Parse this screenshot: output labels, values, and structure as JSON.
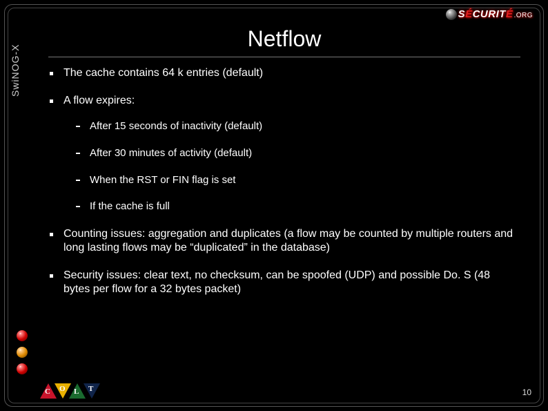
{
  "side_label": "SwiNOG-X",
  "top_logo": {
    "prefix": "S",
    "accent": "É",
    "rest": "CURIT",
    "accent2": "É",
    "suffix": ".ORG"
  },
  "title": "Netflow",
  "bullets": [
    {
      "text": "The cache contains 64 k entries (default)"
    },
    {
      "text": "A flow expires:",
      "sub": [
        "After 15 seconds of inactivity (default)",
        "After 30 minutes of activity (default)",
        "When the RST or FIN flag is set",
        "If the cache is full"
      ]
    },
    {
      "text": "Counting issues: aggregation and duplicates (a flow may be counted by multiple routers and long lasting flows may be “duplicated” in the database)"
    },
    {
      "text": "Security issues: clear text, no checksum, can be spoofed (UDP) and possible Do. S (48 bytes per flow for a 32 bytes packet)"
    }
  ],
  "footer_logo_letters": [
    "C",
    "O",
    "L",
    "T"
  ],
  "page_number": "10"
}
